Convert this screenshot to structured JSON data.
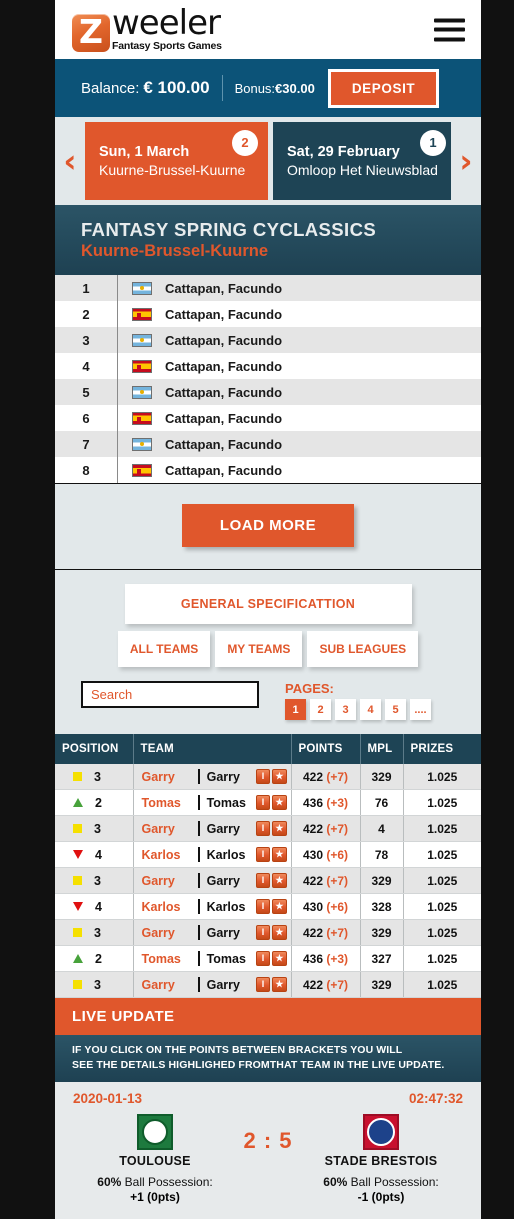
{
  "brand": {
    "logo_mark": "Z",
    "logo_word": "weeler",
    "tagline": "Fantasy Sports Games",
    "menu_icon": "hamburger-menu-icon",
    "accent_orange": "#e0572c",
    "dark_blue": "#0c5378",
    "teal": "#1e4455"
  },
  "account": {
    "balance_label": "Balance:",
    "balance_amount": "€ 100.00",
    "bonus_label": "Bonus:",
    "bonus_amount": "€30.00",
    "deposit_label": "DEPOSIT"
  },
  "date_nav": {
    "prev_icon": "chevron-left-icon",
    "next_icon": "chevron-right-icon",
    "tabs": [
      {
        "day": "Sun, 1 March",
        "race": "Kuurne-Brussel-Kuurne",
        "badge": "2",
        "active": true
      },
      {
        "day": "Sat, 29 February",
        "race": "Omloop Het Nieuwsblad",
        "badge": "1",
        "active": false
      }
    ]
  },
  "fantasy": {
    "title": "FANTASY SPRING CYCLASSICS",
    "subtitle": "Kuurne-Brussel-Kuurne"
  },
  "riders": [
    {
      "pos": "1",
      "flag": "ar",
      "name": "Cattapan, Facundo"
    },
    {
      "pos": "2",
      "flag": "es",
      "name": "Cattapan, Facundo"
    },
    {
      "pos": "3",
      "flag": "ar",
      "name": "Cattapan, Facundo"
    },
    {
      "pos": "4",
      "flag": "es",
      "name": "Cattapan, Facundo"
    },
    {
      "pos": "5",
      "flag": "ar",
      "name": "Cattapan, Facundo"
    },
    {
      "pos": "6",
      "flag": "es",
      "name": "Cattapan, Facundo"
    },
    {
      "pos": "7",
      "flag": "ar",
      "name": "Cattapan, Facundo"
    },
    {
      "pos": "8",
      "flag": "es",
      "name": "Cattapan, Facundo"
    }
  ],
  "load_more_label": "LOAD MORE",
  "controls": {
    "general_spec_label": "GENERAL SPECIFICATTION",
    "tabs": [
      "ALL TEAMS",
      "MY TEAMS",
      "SUB LEAGUES"
    ],
    "search_placeholder": "Search",
    "search_value": "",
    "pages_label": "PAGES:",
    "pages": [
      "1",
      "2",
      "3",
      "4",
      "5",
      "...."
    ],
    "active_page": "1"
  },
  "standings": {
    "columns": [
      "POSITION",
      "TEAM",
      "POINTS",
      "MPL",
      "PRIZES"
    ],
    "rows": [
      {
        "trend": "same",
        "pos": "3",
        "team_a": "Garry",
        "team_b": "Garry",
        "points": "422",
        "delta": "(+7)",
        "mpl": "329",
        "prize": "1.025"
      },
      {
        "trend": "up",
        "pos": "2",
        "team_a": "Tomas",
        "team_b": "Tomas",
        "points": "436",
        "delta": "(+3)",
        "mpl": "76",
        "prize": "1.025"
      },
      {
        "trend": "same",
        "pos": "3",
        "team_a": "Garry",
        "team_b": "Garry",
        "points": "422",
        "delta": "(+7)",
        "mpl": "4",
        "prize": "1.025"
      },
      {
        "trend": "down",
        "pos": "4",
        "team_a": "Karlos",
        "team_b": "Karlos",
        "points": "430",
        "delta": "(+6)",
        "mpl": "78",
        "prize": "1.025"
      },
      {
        "trend": "same",
        "pos": "3",
        "team_a": "Garry",
        "team_b": "Garry",
        "points": "422",
        "delta": "(+7)",
        "mpl": "329",
        "prize": "1.025"
      },
      {
        "trend": "down",
        "pos": "4",
        "team_a": "Karlos",
        "team_b": "Karlos",
        "points": "430",
        "delta": "(+6)",
        "mpl": "328",
        "prize": "1.025"
      },
      {
        "trend": "same",
        "pos": "3",
        "team_a": "Garry",
        "team_b": "Garry",
        "points": "422",
        "delta": "(+7)",
        "mpl": "329",
        "prize": "1.025"
      },
      {
        "trend": "up",
        "pos": "2",
        "team_a": "Tomas",
        "team_b": "Tomas",
        "points": "436",
        "delta": "(+3)",
        "mpl": "327",
        "prize": "1.025"
      },
      {
        "trend": "same",
        "pos": "3",
        "team_a": "Garry",
        "team_b": "Garry",
        "points": "422",
        "delta": "(+7)",
        "mpl": "329",
        "prize": "1.025"
      }
    ],
    "row_badges": {
      "info": "I",
      "star": "★"
    }
  },
  "live_update": {
    "heading": "LIVE UPDATE",
    "note_line1": "IF YOU CLICK ON THE POINTS BETWEEN BRACKETS YOU WILL",
    "note_line2": "SEE THE DETAILS HIGHLIGHED FROMTHAT TEAM IN THE LIVE UPDATE.",
    "date": "2020-01-13",
    "time": "02:47:32",
    "score": "2 : 5",
    "home": {
      "crest": "toulouse-crest-icon",
      "name": "TOULOUSE",
      "possession_pct": "60%",
      "possession_label": "Ball Possession:",
      "delta": "+1 (0pts)"
    },
    "away": {
      "crest": "stade-brestois-crest-icon",
      "name": "STADE BRESTOIS",
      "possession_pct": "60%",
      "possession_label": "Ball Possession:",
      "delta": "-1 (0pts)"
    }
  }
}
